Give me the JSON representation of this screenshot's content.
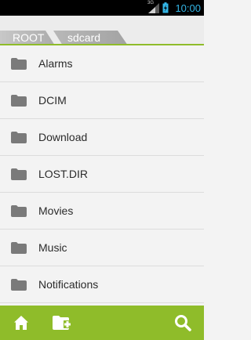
{
  "status_bar": {
    "network": "3G",
    "time": "10:00",
    "icons": [
      "signal-icon",
      "battery-icon"
    ],
    "clock_color": "#33b5e5"
  },
  "breadcrumb": {
    "items": [
      {
        "label": "ROOT"
      },
      {
        "label": "sdcard"
      }
    ]
  },
  "folders": [
    {
      "name": "Alarms",
      "icon": "folder-icon"
    },
    {
      "name": "DCIM",
      "icon": "folder-icon"
    },
    {
      "name": "Download",
      "icon": "folder-icon"
    },
    {
      "name": "LOST.DIR",
      "icon": "folder-icon"
    },
    {
      "name": "Movies",
      "icon": "folder-icon"
    },
    {
      "name": "Music",
      "icon": "folder-icon"
    },
    {
      "name": "Notifications",
      "icon": "folder-icon"
    },
    {
      "name": "",
      "icon": "folder-icon"
    }
  ],
  "action_bar": {
    "buttons": [
      {
        "icon": "home-icon"
      },
      {
        "icon": "new-folder-icon"
      },
      {
        "icon": "search-icon"
      }
    ]
  },
  "colors": {
    "accent": "#8fbc2a",
    "folder_icon": "#7a7a7a",
    "list_background": "#f3f3f3"
  }
}
